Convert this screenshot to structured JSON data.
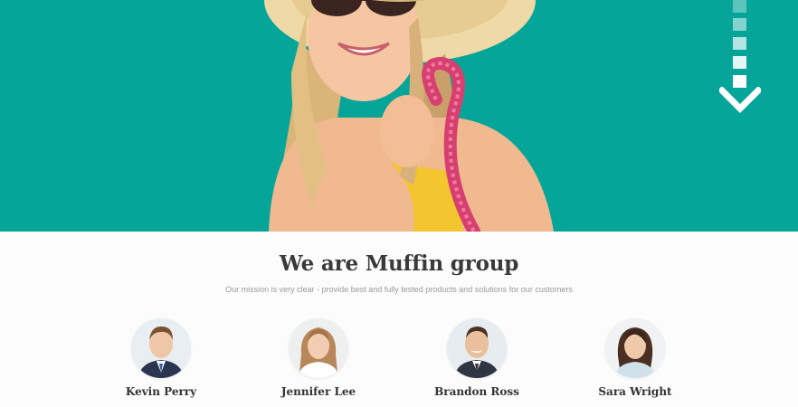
{
  "colors": {
    "hero_background": "#06a599",
    "headline": "#3a3a3a",
    "mission_text": "#9a9a9a",
    "page_background": "#fcfcfc"
  },
  "hero": {
    "image": "woman-in-sun-hat-photo",
    "scroll_indicator": "arrow-down-icon"
  },
  "about": {
    "title": "We are Muffin group",
    "mission": "Our mission is very clear - provide best and fully tested products and solutions for our customers"
  },
  "team": [
    {
      "name": "Kevin Perry",
      "photo": "avatar-man-suit"
    },
    {
      "name": "Jennifer Lee",
      "photo": "avatar-woman-long-hair"
    },
    {
      "name": "Brandon Ross",
      "photo": "avatar-man-smiling"
    },
    {
      "name": "Sara Wright",
      "photo": "avatar-woman-dark-hair"
    }
  ]
}
